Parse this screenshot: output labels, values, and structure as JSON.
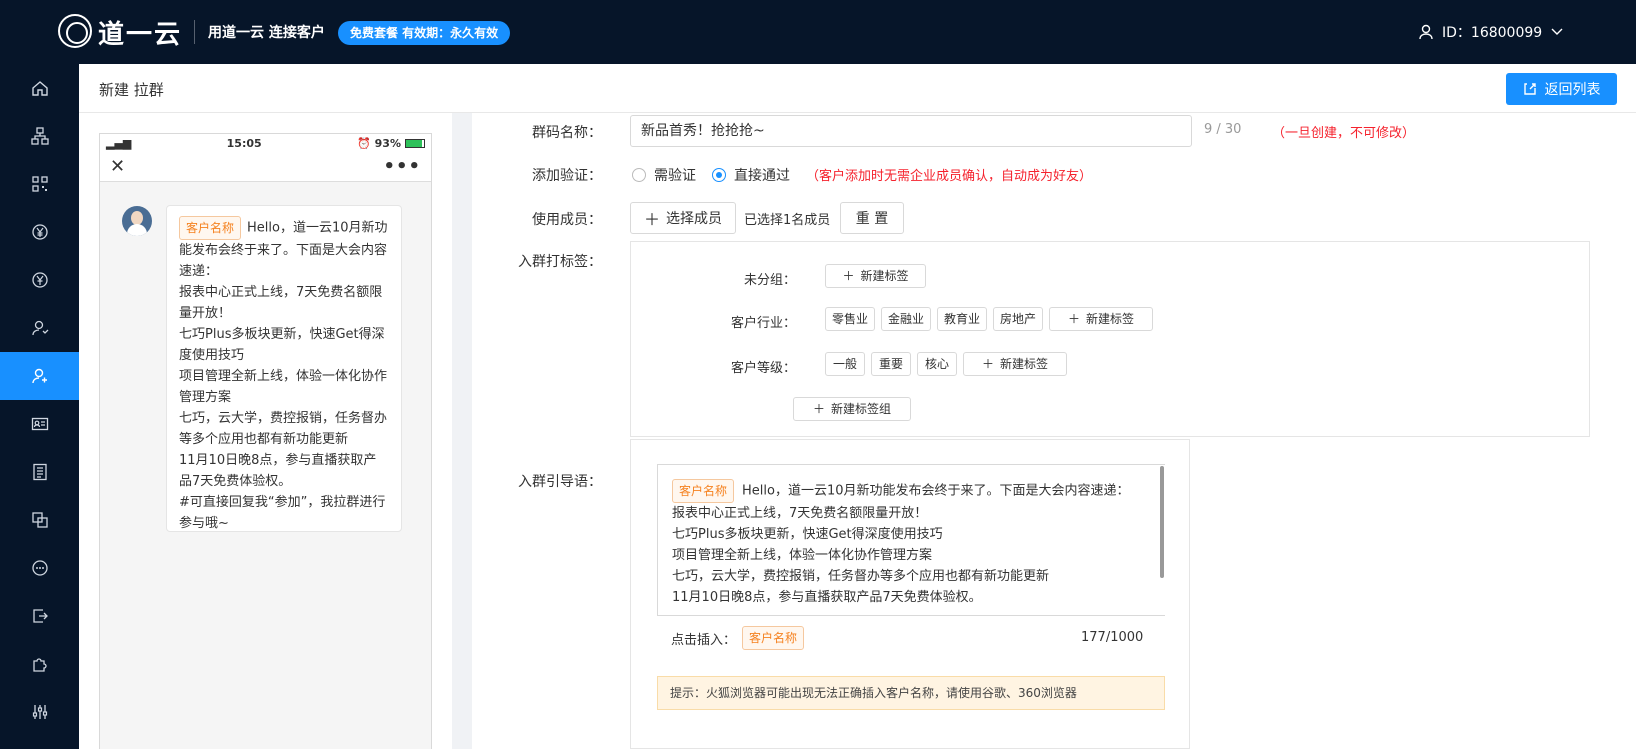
{
  "topbar": {
    "logo_text": "道一云",
    "slogan": "用道一云 连接客户",
    "plan_badge": "免费套餐 有效期：永久有效",
    "user_id": "ID：16800099"
  },
  "sidebar": {
    "items": [
      {
        "icon": "home-icon"
      },
      {
        "icon": "org-chart-icon"
      },
      {
        "icon": "qrcode-icon"
      },
      {
        "icon": "yen-icon"
      },
      {
        "icon": "yen-circle-icon"
      },
      {
        "icon": "customer-icon"
      },
      {
        "icon": "group-customer-icon",
        "active": true
      },
      {
        "icon": "id-card-icon"
      },
      {
        "icon": "document-icon"
      },
      {
        "icon": "copy-icon"
      },
      {
        "icon": "chat-icon"
      },
      {
        "icon": "exit-icon"
      },
      {
        "icon": "puzzle-icon"
      },
      {
        "icon": "settings-sliders-icon"
      }
    ]
  },
  "header": {
    "title": "新建 拉群",
    "back_button": "返回列表"
  },
  "preview": {
    "status_time": "15:05",
    "status_battery": "93%",
    "message_tag": "客户名称",
    "message_lines": [
      "Hello，道一云10月新功能发布会终于来了。下面是大会内容速递：",
      "报表中心正式上线，7天免费名额限量开放！",
      "七巧Plus多板块更新，快速Get得深度使用技巧",
      "项目管理全新上线，体验一体化协作管理方案",
      "七巧，云大学，费控报销，任务督办等多个应用也都有新功能更新",
      "11月10日晚8点，参与直播获取产品7天免费体验权。",
      "#可直接回复我“参加”，我拉群进行参与哦~"
    ]
  },
  "form": {
    "name_label": "群码名称：",
    "name_value": "新品首秀！抢抢抢~",
    "name_count": "9 / 30",
    "name_note": "（一旦创建，不可修改）",
    "verify_label": "添加验证：",
    "verify_options": [
      "需验证",
      "直接通过"
    ],
    "verify_note": "（客户添加时无需企业成员确认，自动成为好友）",
    "members_label": "使用成员：",
    "select_members": "选择成员",
    "members_selected": "已选择1名成员",
    "reset": "重 置",
    "tags_label": "入群打标签：",
    "tag_groups": [
      {
        "name": "未分组：",
        "tags": [],
        "add": "新建标签"
      },
      {
        "name": "客户行业：",
        "tags": [
          "零售业",
          "金融业",
          "教育业",
          "房地产"
        ],
        "add": "新建标签"
      },
      {
        "name": "客户等级：",
        "tags": [
          "一般",
          "重要",
          "核心"
        ],
        "add": "新建标签"
      }
    ],
    "new_tag_group": "新建标签组",
    "guide_label": "入群引导语：",
    "guide_tag": "客户名称",
    "guide_lines": [
      "Hello，道一云10月新功能发布会终于来了。下面是大会内容速递：",
      "报表中心正式上线，7天免费名额限量开放！",
      "七巧Plus多板块更新，快速Get得深度使用技巧",
      "项目管理全新上线，体验一体化协作管理方案",
      "七巧，云大学，费控报销，任务督办等多个应用也都有新功能更新",
      "11月10日晚8点，参与直播获取产品7天免费体验权。"
    ],
    "insert_label": "点击插入：",
    "insert_tag": "客户名称",
    "guide_count": "177/1000",
    "tip": "提示：火狐浏览器可能出现无法正确插入客户名称，请使用谷歌、360浏览器"
  }
}
